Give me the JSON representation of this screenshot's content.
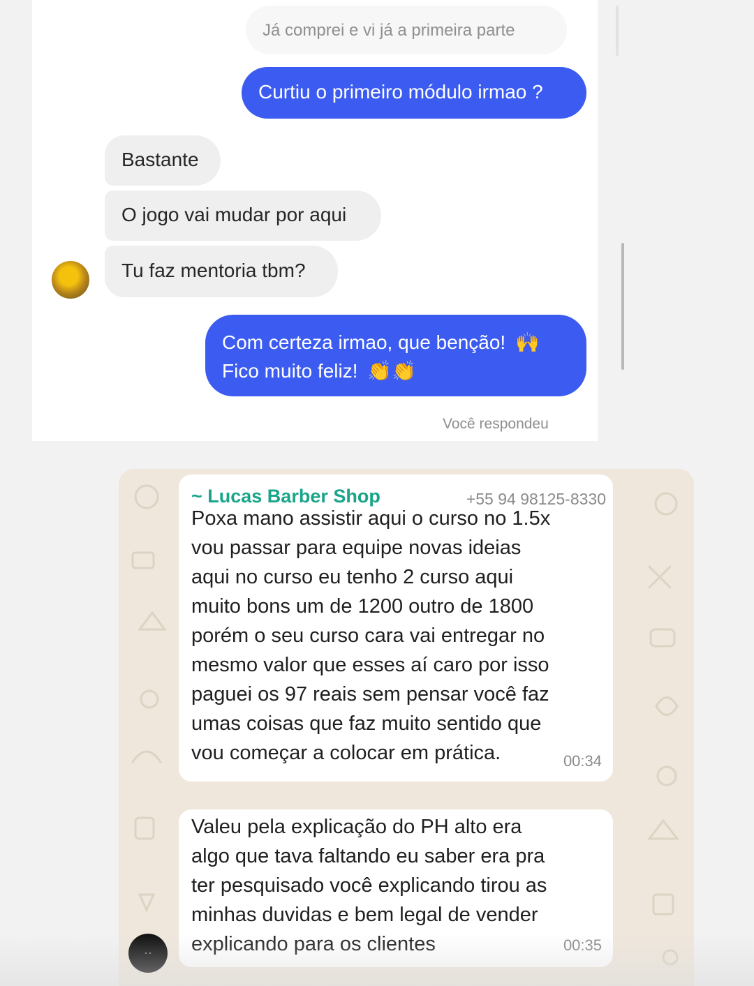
{
  "instagram": {
    "messages": [
      {
        "side": "received",
        "text": "Já comprei e vi já a primeira parte"
      },
      {
        "side": "sent",
        "text": "Curtiu o primeiro módulo irmao ?"
      },
      {
        "side": "received",
        "text": "Bastante"
      },
      {
        "side": "received",
        "text": "O jogo vai mudar por aqui"
      },
      {
        "side": "received",
        "text": "Tu faz mentoria tbm?"
      },
      {
        "side": "sent",
        "line1": "Com certeza irmao, que benção!",
        "line2": "Fico muito feliz!",
        "emoji1": "🙌",
        "emoji2": "👏👏"
      }
    ],
    "status": "Você respondeu",
    "accent_color": "#3b5bf1"
  },
  "whatsapp": {
    "sender": "~ Lucas Barber Shop",
    "phone": "+55 94 98125-8330",
    "sender_color": "#1aa58a",
    "messages": [
      {
        "text": "Poxa mano assistir aqui o curso no 1.5x\nvou passar para equipe novas ideias\naqui no curso eu tenho 2 curso aqui\nmuito bons um de 1200 outro de 1800\nporém o seu curso cara vai entregar no\nmesmo valor que esses aí caro por isso\npaguei os 97 reais sem pensar você faz\numas coisas que faz muito sentido que\nvou começar a colocar em prática.",
        "time": "00:34"
      },
      {
        "text": "Valeu pela explicação do PH alto era\nalgo que tava faltando eu saber era pra\nter pesquisado você explicando tirou as\nminhas duvidas e bem legal de vender\nexplicando para os clientes",
        "time": "00:35"
      }
    ]
  }
}
